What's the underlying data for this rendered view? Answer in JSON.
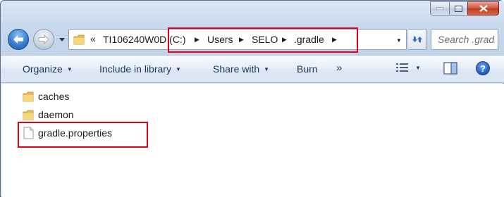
{
  "window": {
    "address": {
      "overflow_label": "«",
      "crumbs": [
        {
          "label": "TI106240W0D (C:)"
        },
        {
          "label": "Users"
        },
        {
          "label": "SELO"
        },
        {
          "label": ".gradle"
        }
      ]
    },
    "search": {
      "placeholder": "Search .gradle"
    }
  },
  "toolbar": {
    "organize": "Organize",
    "include_in_library": "Include in library",
    "share_with": "Share with",
    "burn": "Burn",
    "more": "»",
    "help": "?"
  },
  "files": [
    {
      "name": "caches",
      "kind": "folder"
    },
    {
      "name": "daemon",
      "kind": "folder"
    },
    {
      "name": "gradle.properties",
      "kind": "file"
    }
  ],
  "colors": {
    "highlight": "#e3001b",
    "folder": "#e8c15a",
    "command_text": "#1e395b"
  },
  "icons": [
    "minimize-icon",
    "maximize-icon",
    "close-icon",
    "back-arrow-icon",
    "forward-arrow-icon",
    "folder-icon",
    "refresh-icon",
    "search-icon",
    "view-options-icon",
    "preview-pane-icon",
    "help-icon",
    "file-icon"
  ]
}
